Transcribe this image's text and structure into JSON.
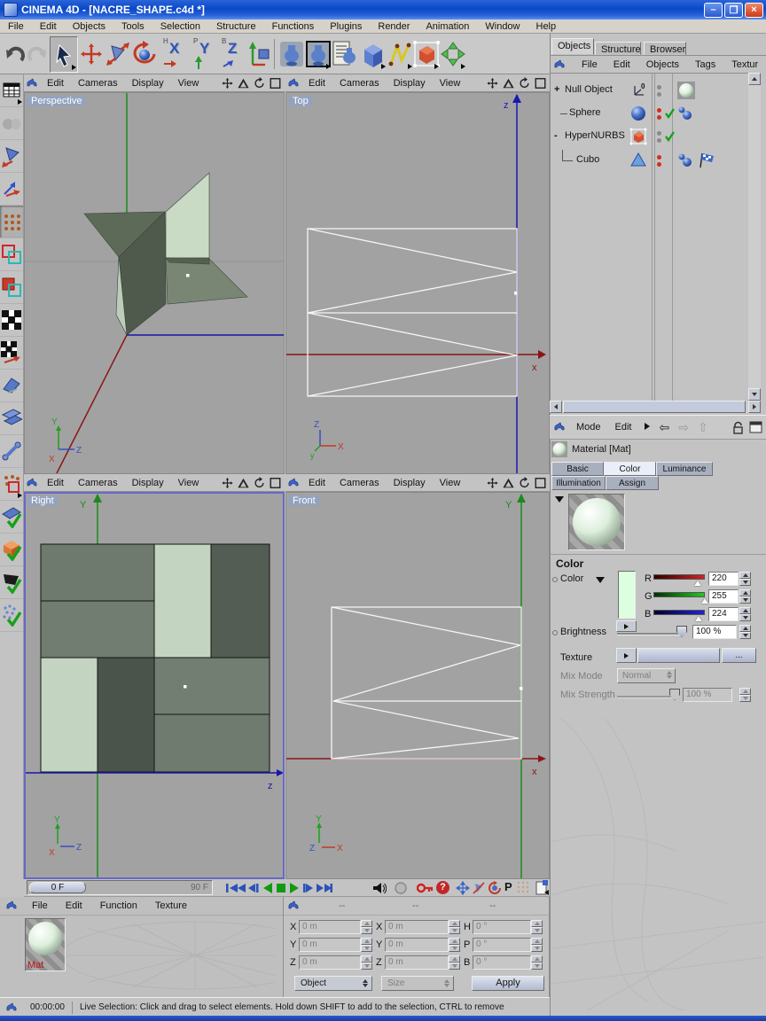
{
  "window": {
    "title": "CINEMA 4D - [NACRE_SHAPE.c4d *]"
  },
  "menu": [
    "File",
    "Edit",
    "Objects",
    "Tools",
    "Selection",
    "Structure",
    "Functions",
    "Plugins",
    "Render",
    "Animation",
    "Window",
    "Help"
  ],
  "toolbar": {
    "axis_locks": [
      {
        "small": "H",
        "big": "X"
      },
      {
        "small": "P",
        "big": "Y"
      },
      {
        "small": "B",
        "big": "Z"
      }
    ]
  },
  "viewport_menu": [
    "Edit",
    "Cameras",
    "Display",
    "View"
  ],
  "viewports": {
    "perspective": {
      "label": "Perspective",
      "gizmo_y": "Y",
      "gizmo_x": "X",
      "gizmo_z": "Z"
    },
    "top": {
      "label": "Top",
      "axis_vertical": "z",
      "axis_horizontal": "x",
      "gizmo_z": "Z",
      "gizmo_x": "X",
      "gizmo_y": "y"
    },
    "right": {
      "label": "Right",
      "axis_vertical": "Y",
      "axis_horizontal": "z",
      "gizmo_y": "Y",
      "gizmo_x": "X",
      "gizmo_z": "Z"
    },
    "front": {
      "label": "Front",
      "axis_vertical": "Y",
      "axis_horizontal": "x",
      "gizmo_y": "Y",
      "gizmo_z": "Z",
      "gizmo_x": "X"
    }
  },
  "object_manager": {
    "tabs": [
      "Objects",
      "Structure",
      "Browser"
    ],
    "active_tab": "Objects",
    "menu": [
      "File",
      "Edit",
      "Objects",
      "Tags",
      "Textur"
    ],
    "null_icon_label": "0",
    "items": [
      {
        "name": "Null Object",
        "expander": "+"
      },
      {
        "name": "Sphere",
        "expander": ""
      },
      {
        "name": "HyperNURBS",
        "expander": "-"
      },
      {
        "name": "Cubo",
        "expander": ""
      }
    ]
  },
  "material_editor": {
    "menu": [
      "Mode",
      "Edit"
    ],
    "title": "Material [Mat]",
    "tabs": [
      "Basic",
      "Color",
      "Luminance",
      "Illumination",
      "Assign"
    ],
    "active_tab": "Color",
    "section_title": "Color",
    "color_label": "Color",
    "swatch_color": "#dcffe0",
    "channels": [
      {
        "label": "R",
        "value": "220"
      },
      {
        "label": "G",
        "value": "255"
      },
      {
        "label": "B",
        "value": "224"
      }
    ],
    "brightness_label": "Brightness",
    "brightness_value": "100 %",
    "texture_label": "Texture",
    "browse_label": "...",
    "mix_mode_label": "Mix Mode",
    "mix_mode_value": "Normal",
    "mix_strength_label": "Mix Strength",
    "mix_strength_value": "100 %"
  },
  "timeline": {
    "current_frame": "0 F",
    "end_frame": "90 F",
    "p_button": "P",
    "help_button": "?"
  },
  "material_manager": {
    "menu": [
      "File",
      "Edit",
      "Function",
      "Texture"
    ],
    "material_name": "Mat"
  },
  "coordinates": {
    "header_placeholder": "--",
    "position": {
      "labels": [
        "X",
        "Y",
        "Z"
      ],
      "values": [
        "0 m",
        "0 m",
        "0 m"
      ]
    },
    "size": {
      "labels": [
        "X",
        "Y",
        "Z"
      ],
      "values": [
        "0 m",
        "0 m",
        "0 m"
      ]
    },
    "rotation": {
      "labels": [
        "H",
        "P",
        "B"
      ],
      "values": [
        "0 °",
        "0 °",
        "0 °"
      ]
    },
    "mode_dropdown": "Object",
    "size_dropdown": "Size",
    "apply_button": "Apply"
  },
  "status_bar": {
    "time": "00:00:00",
    "message": "Live Selection: Click and drag to select elements. Hold down SHIFT to add to the selection, CTRL to remove"
  }
}
